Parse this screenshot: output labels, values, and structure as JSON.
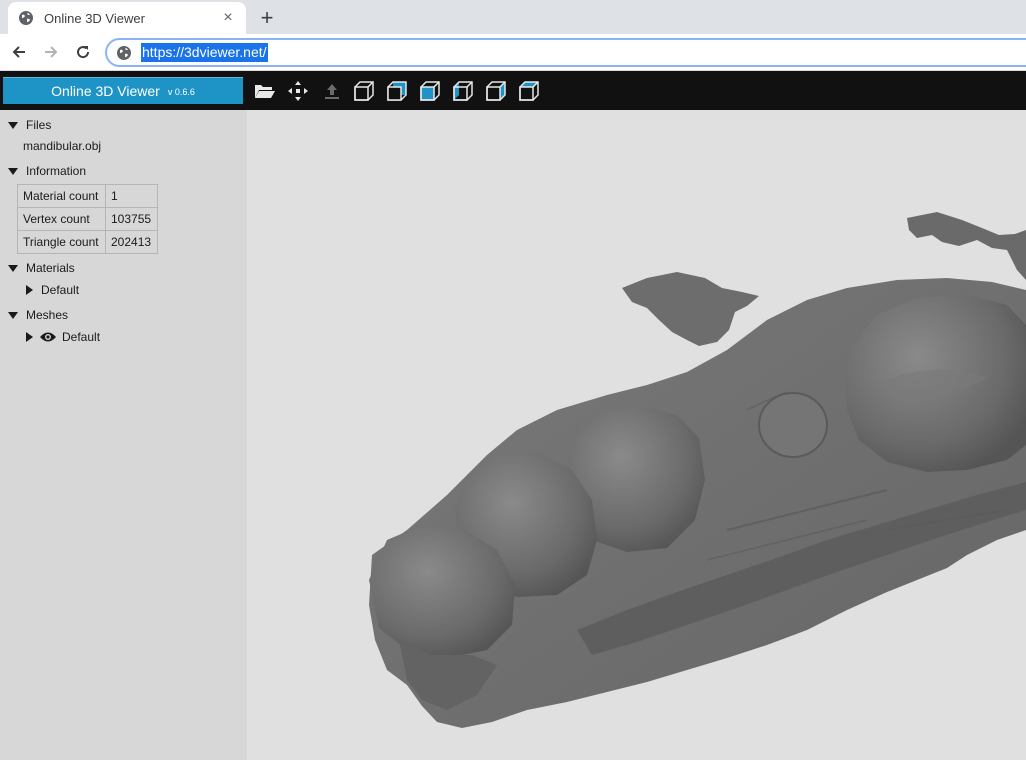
{
  "browser": {
    "tab_title": "Online 3D Viewer",
    "tab_close": "×",
    "new_tab": "+",
    "url": "https://3dviewer.net/"
  },
  "app": {
    "title": "Online 3D Viewer",
    "version": "v 0.6.6",
    "accent_color": "#1e94c6",
    "toolbar_icons": [
      "open-folder-icon",
      "fit-to-window-icon",
      "upward-direction-icon",
      "front-view-icon",
      "back-view-icon",
      "left-view-icon",
      "right-view-icon",
      "top-view-icon",
      "bottom-view-icon"
    ]
  },
  "panel": {
    "files": {
      "label": "Files",
      "items": [
        "mandibular.obj"
      ]
    },
    "information": {
      "label": "Information",
      "rows": [
        {
          "key": "Material count",
          "value": "1"
        },
        {
          "key": "Vertex count",
          "value": "103755"
        },
        {
          "key": "Triangle count",
          "value": "202413"
        }
      ]
    },
    "materials": {
      "label": "Materials",
      "items": [
        "Default"
      ]
    },
    "meshes": {
      "label": "Meshes",
      "items": [
        "Default"
      ]
    }
  },
  "viewport": {
    "model_color": "#6e6e6e",
    "background": "#e0e0e0"
  }
}
